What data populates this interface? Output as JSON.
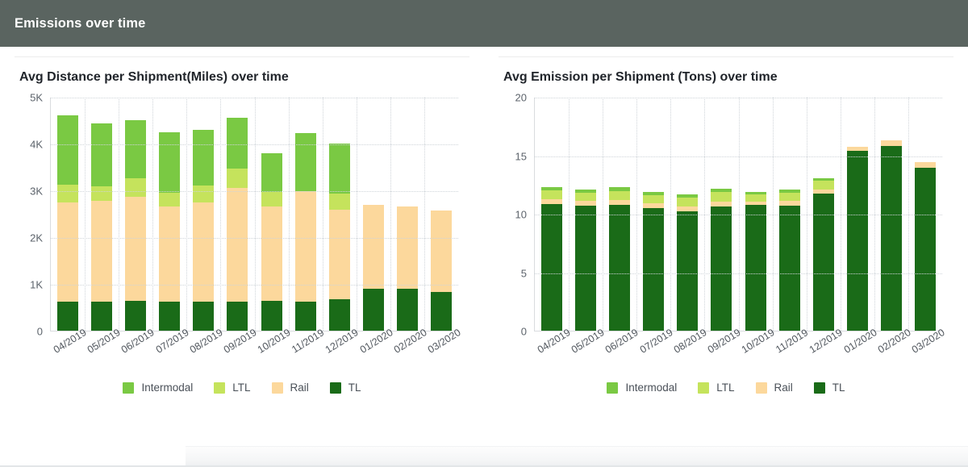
{
  "header": {
    "title": "Emissions over time"
  },
  "legend": {
    "items": [
      {
        "label": "Intermodal",
        "color": "#7ac943"
      },
      {
        "label": "LTL",
        "color": "#c5e35c"
      },
      {
        "label": "Rail",
        "color": "#fcd89c"
      },
      {
        "label": "TL",
        "color": "#1a6b18"
      }
    ]
  },
  "charts": [
    {
      "title": "Avg Distance per Shipment(Miles) over time",
      "chart_data": {
        "type": "bar",
        "stacked": true,
        "title": "Avg Distance per Shipment(Miles) over time",
        "xlabel": "",
        "ylabel": "",
        "ylim": [
          0,
          5000
        ],
        "yticks": [
          0,
          1000,
          2000,
          3000,
          4000,
          5000
        ],
        "ytick_labels": [
          "0",
          "1K",
          "2K",
          "3K",
          "4K",
          "5K"
        ],
        "grid": true,
        "legend_position": "bottom",
        "categories": [
          "04/2019",
          "05/2019",
          "06/2019",
          "07/2019",
          "08/2019",
          "09/2019",
          "10/2019",
          "11/2019",
          "12/2019",
          "01/2020",
          "02/2020",
          "03/2020"
        ],
        "series": [
          {
            "name": "TL",
            "color": "#1a6b18",
            "values": [
              620,
              620,
              630,
              615,
              620,
              620,
              630,
              615,
              670,
              890,
              900,
              820
            ]
          },
          {
            "name": "Rail",
            "color": "#fcd89c",
            "values": [
              2130,
              2150,
              2240,
              2040,
              2130,
              2440,
              2020,
              2370,
              1920,
              1800,
              1750,
              1750
            ]
          },
          {
            "name": "LTL",
            "color": "#c5e35c",
            "values": [
              370,
              320,
              390,
              290,
              360,
              400,
              320,
              0,
              340,
              0,
              0,
              0
            ]
          },
          {
            "name": "Intermodal",
            "color": "#7ac943",
            "values": [
              1480,
              1350,
              1240,
              1300,
              1190,
              1100,
              830,
              1240,
              1070,
              0,
              0,
              0
            ]
          }
        ],
        "totals": [
          4600,
          4440,
          4500,
          4245,
          4300,
          4560,
          3800,
          4225,
          4000,
          2690,
          2650,
          2570
        ]
      }
    },
    {
      "title": "Avg Emission per Shipment (Tons) over time",
      "chart_data": {
        "type": "bar",
        "stacked": true,
        "title": "Avg Emission per Shipment (Tons) over time",
        "xlabel": "",
        "ylabel": "",
        "ylim": [
          0,
          20
        ],
        "yticks": [
          0,
          5,
          10,
          15,
          20
        ],
        "ytick_labels": [
          "0",
          "5",
          "10",
          "15",
          "20"
        ],
        "grid": true,
        "legend_position": "bottom",
        "categories": [
          "04/2019",
          "05/2019",
          "06/2019",
          "07/2019",
          "08/2019",
          "09/2019",
          "10/2019",
          "11/2019",
          "12/2019",
          "01/2020",
          "02/2020",
          "03/2020"
        ],
        "series": [
          {
            "name": "TL",
            "color": "#1a6b18",
            "values": [
              10.8,
              10.7,
              10.75,
              10.45,
              10.2,
              10.6,
              10.75,
              10.7,
              11.75,
              15.35,
              15.8,
              13.95
            ]
          },
          {
            "name": "Rail",
            "color": "#fcd89c",
            "values": [
              0.45,
              0.42,
              0.45,
              0.42,
              0.4,
              0.42,
              0.3,
              0.42,
              0.35,
              0.35,
              0.45,
              0.45
            ]
          },
          {
            "name": "LTL",
            "color": "#c5e35c",
            "values": [
              0.75,
              0.7,
              0.75,
              0.7,
              0.75,
              0.82,
              0.6,
              0.7,
              0.7,
              0,
              0,
              0
            ]
          },
          {
            "name": "Intermodal",
            "color": "#7ac943",
            "values": [
              0.3,
              0.28,
              0.3,
              0.28,
              0.3,
              0.31,
              0.2,
              0.28,
              0.25,
              0,
              0,
              0
            ]
          }
        ],
        "totals": [
          12.3,
          12.1,
          12.25,
          11.85,
          11.65,
          12.15,
          11.85,
          12.1,
          13.05,
          15.7,
          16.25,
          14.4
        ]
      }
    }
  ]
}
